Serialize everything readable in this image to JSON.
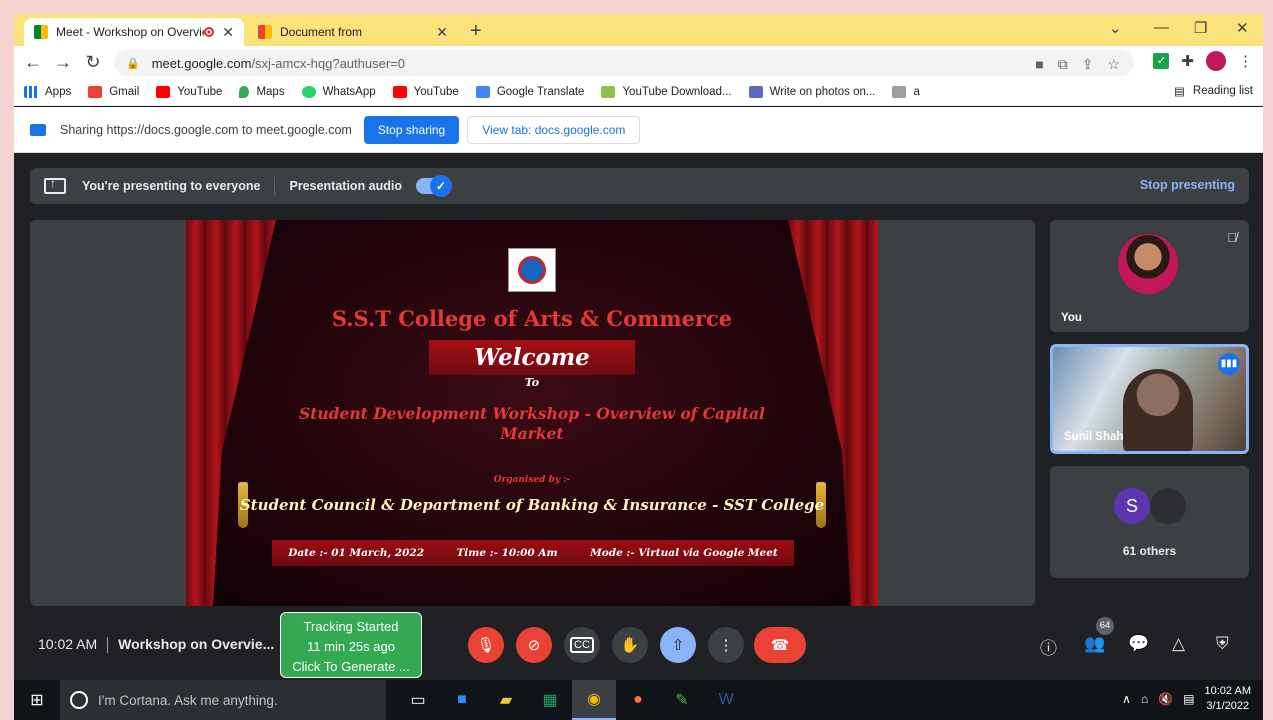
{
  "browser": {
    "tabs": [
      {
        "title": "Meet - Workshop on Overvie",
        "active": true
      },
      {
        "title": "Document from",
        "active": false
      }
    ],
    "url_host": "meet.google.com",
    "url_path": "/sxj-amcx-hqg?authuser=0",
    "bookmarks": [
      "Apps",
      "Gmail",
      "YouTube",
      "Maps",
      "WhatsApp",
      "YouTube",
      "Google Translate",
      "YouTube Download...",
      "Write on photos on...",
      "a"
    ],
    "reading_list": "Reading list"
  },
  "sharing_bar": {
    "text": "Sharing https://docs.google.com to meet.google.com",
    "stop_label": "Stop sharing",
    "view_label": "View tab: docs.google.com"
  },
  "presenting_bar": {
    "text": "You're presenting to everyone",
    "audio_label": "Presentation audio",
    "stop_label": "Stop presenting"
  },
  "slide": {
    "college": "S.S.T College of Arts & Commerce",
    "welcome": "Welcome",
    "to": "To",
    "workshop": "Student Development Workshop  - Overview of Capital Market",
    "organised_by": "Organised by :-",
    "council": "Student Council & Department of Banking & Insurance  - SST College",
    "date": "Date :-  01 March, 2022",
    "time": "Time :- 10:00 Am",
    "mode": "Mode :- Virtual via Google Meet"
  },
  "participants": {
    "you_label": "You",
    "speaker_label": "Sunil Shah",
    "others_initial": "S",
    "others_label": "61 others",
    "count_badge": "64"
  },
  "meetbar": {
    "time": "10:02 AM",
    "meeting_name": "Workshop on Overvie...",
    "tracker_line1": "Tracking Started",
    "tracker_line2": "11 min 25s ago",
    "tracker_line3": "Click To Generate ..."
  },
  "taskbar": {
    "cortana_placeholder": "I'm Cortana. Ask me anything.",
    "clock_time": "10:02 AM",
    "clock_date": "3/1/2022"
  },
  "colors": {
    "accent": "#1a73e8",
    "meet_dark": "#202124",
    "danger": "#ea4335",
    "tracker": "#34a853",
    "tab_strip": "#fbe27a"
  }
}
